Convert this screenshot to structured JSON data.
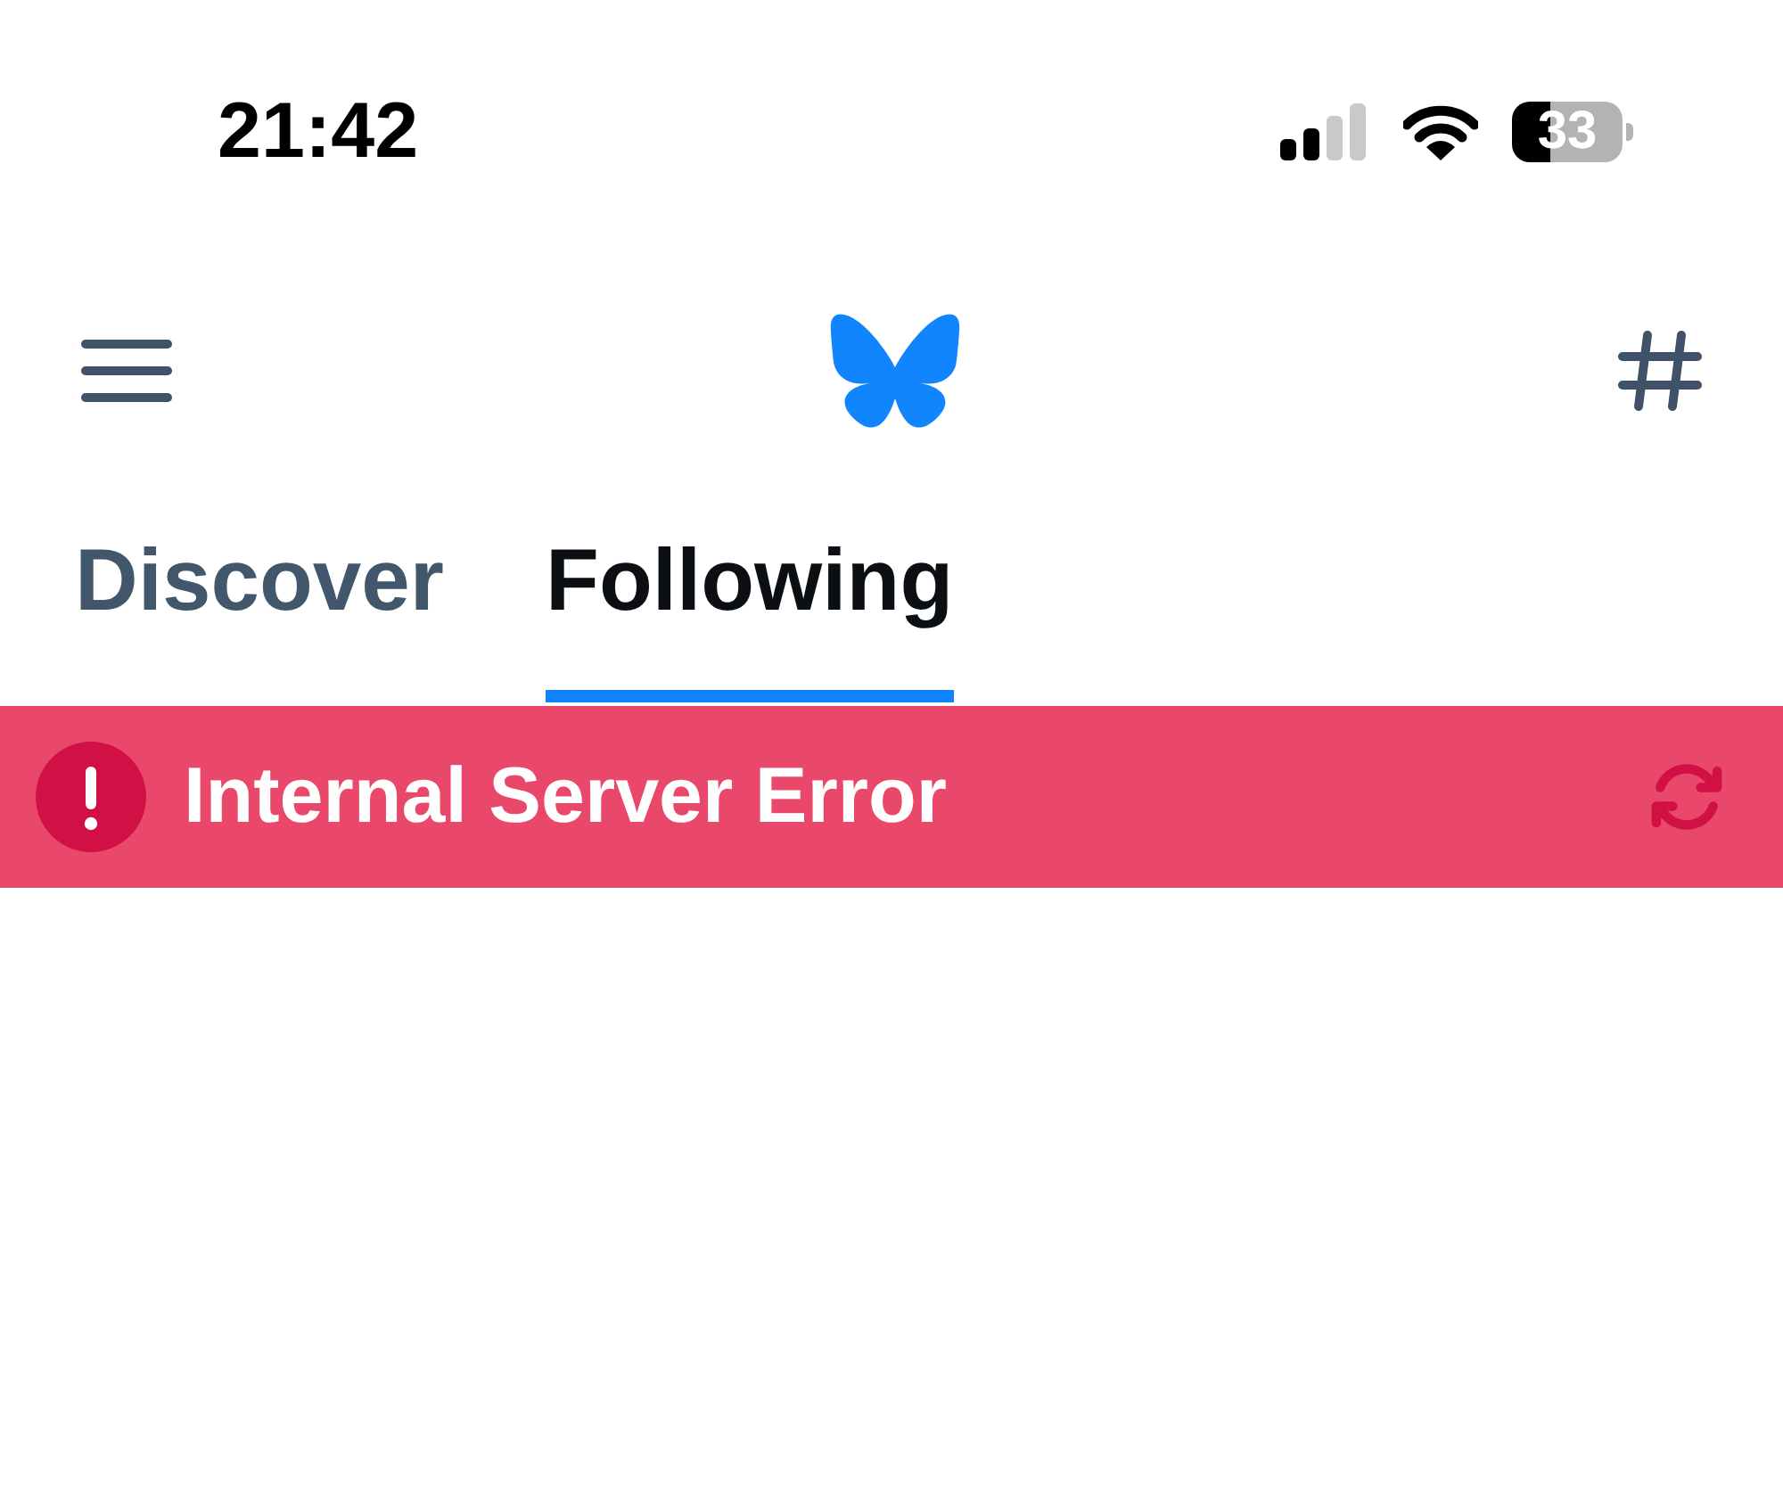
{
  "status_bar": {
    "time": "21:42",
    "battery_text": "33"
  },
  "tabs": [
    {
      "label": "Discover",
      "selected": false
    },
    {
      "label": "Following",
      "selected": true
    }
  ],
  "error_banner": {
    "message": "Internal Server Error"
  }
}
